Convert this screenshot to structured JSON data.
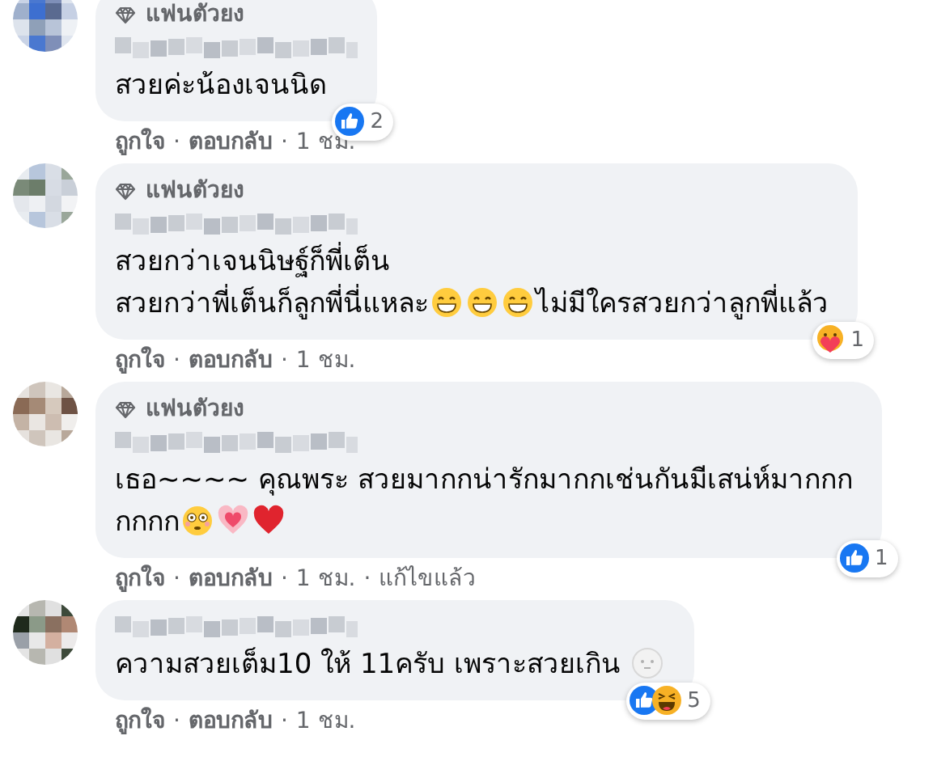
{
  "comments": [
    {
      "badge": "แฟนตัวยง",
      "lines": [
        [
          {
            "kind": "text",
            "text": "สวยค่ะน้องเจนนิด"
          }
        ]
      ],
      "reactions": {
        "items": [
          {
            "kind": "like"
          }
        ],
        "count": "2"
      },
      "footer": [
        {
          "kind": "link",
          "text": "ถูกใจ"
        },
        {
          "kind": "separator",
          "text": "·"
        },
        {
          "kind": "link",
          "text": "ตอบกลับ"
        },
        {
          "kind": "separator",
          "text": "·"
        },
        {
          "kind": "time",
          "text": "1 ชม."
        }
      ]
    },
    {
      "badge": "แฟนตัวยง",
      "lines": [
        [
          {
            "kind": "text",
            "text": "สวยกว่าเจนนิษฐ์ก็พี่เต็น"
          }
        ],
        [
          {
            "kind": "text",
            "text": "สวยกว่าพี่เต็นก็ลูกพี่นี่แหละ"
          },
          {
            "kind": "grin"
          },
          {
            "kind": "grin"
          },
          {
            "kind": "grin"
          },
          {
            "kind": "text",
            "text": "ไม่มีใครสวยกว่าลูกพี่แล้ว"
          }
        ]
      ],
      "reactions": {
        "items": [
          {
            "kind": "care"
          }
        ],
        "count": "1"
      },
      "footer": [
        {
          "kind": "link",
          "text": "ถูกใจ"
        },
        {
          "kind": "separator",
          "text": "·"
        },
        {
          "kind": "link",
          "text": "ตอบกลับ"
        },
        {
          "kind": "separator",
          "text": "·"
        },
        {
          "kind": "time",
          "text": "1 ชม."
        }
      ]
    },
    {
      "badge": "แฟนตัวยง",
      "lines": [
        [
          {
            "kind": "text",
            "text": "เธอ~~~~ คุณพระ สวยมากกน่ารักมากกเช่นกันมีเสน่ห์มากกก"
          }
        ],
        [
          {
            "kind": "text",
            "text": "กกกก"
          },
          {
            "kind": "flushed"
          },
          {
            "kind": "sparkleheart"
          },
          {
            "kind": "heart"
          }
        ]
      ],
      "reactions": {
        "items": [
          {
            "kind": "like"
          }
        ],
        "count": "1"
      },
      "footer": [
        {
          "kind": "link",
          "text": "ถูกใจ"
        },
        {
          "kind": "separator",
          "text": "·"
        },
        {
          "kind": "link",
          "text": "ตอบกลับ"
        },
        {
          "kind": "separator",
          "text": "·"
        },
        {
          "kind": "time",
          "text": "1 ชม."
        },
        {
          "kind": "separator",
          "text": "·"
        },
        {
          "kind": "time",
          "text": "แก้ไขแล้ว"
        }
      ]
    },
    {
      "lines": [
        [
          {
            "kind": "text",
            "text": "ความสวยเต็ม10 ให้ 11ครับ เพราะสวยเกิน "
          },
          {
            "kind": "moon"
          }
        ]
      ],
      "reactions": {
        "items": [
          {
            "kind": "like"
          },
          {
            "kind": "haha"
          }
        ],
        "count": "5"
      },
      "footer": [
        {
          "kind": "link",
          "text": "ถูกใจ"
        },
        {
          "kind": "separator",
          "text": "·"
        },
        {
          "kind": "link",
          "text": "ตอบกลับ"
        },
        {
          "kind": "separator",
          "text": "·"
        },
        {
          "kind": "time",
          "text": "1 ชม."
        }
      ]
    }
  ]
}
